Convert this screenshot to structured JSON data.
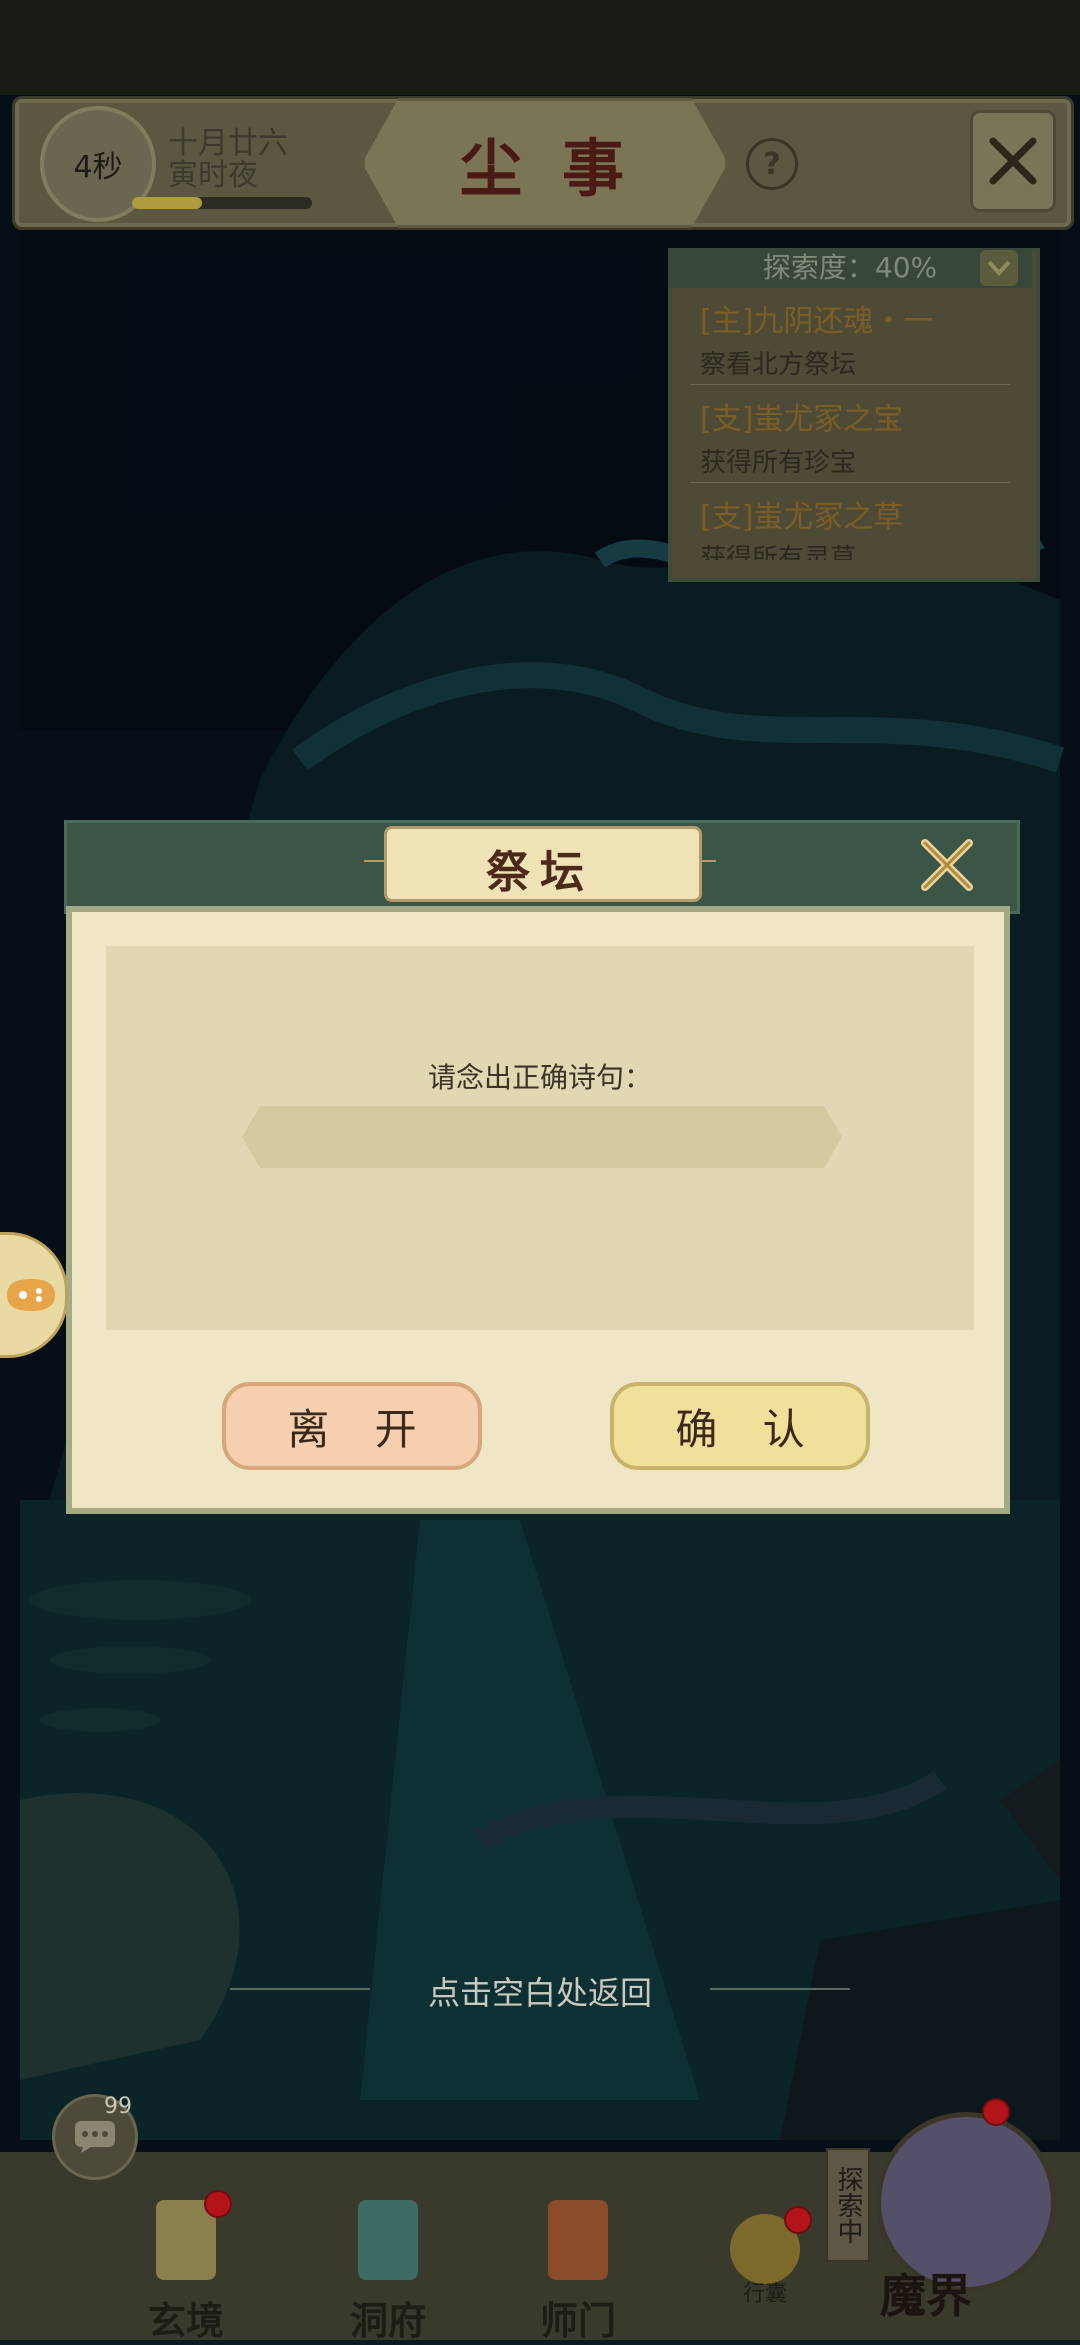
{
  "header": {
    "timer": "4秒",
    "date_line1": "十月廿六",
    "date_line2": "寅时夜",
    "title": "尘事",
    "help_icon": "question-icon",
    "close_icon": "crossed-swords-close-icon"
  },
  "quest_panel": {
    "progress_label": "探索度：40%",
    "quests": [
      {
        "title": "[主]九阴还魂・一",
        "desc": "察看北方祭坛"
      },
      {
        "title": "[支]蚩尤冢之宝",
        "desc": "获得所有珍宝"
      },
      {
        "title": "[支]蚩尤冢之草",
        "desc": "获得所有灵草"
      }
    ]
  },
  "dialog": {
    "title": "祭坛",
    "prompt": "请念出正确诗句：",
    "input_value": "",
    "input_placeholder": "",
    "leave_label": "离 开",
    "confirm_label": "确 认"
  },
  "return_hint": "点击空白处返回",
  "chat": {
    "badge": "99"
  },
  "bottom_nav": {
    "items": [
      {
        "label": "玄境"
      },
      {
        "label": "洞府"
      },
      {
        "label": "师门"
      }
    ],
    "bag_label": "行囊",
    "explore_tag": "探索中",
    "demon_realm_label": "魔界"
  },
  "colors": {
    "dialog_bg": "#efe6c6",
    "leave_btn": "#f5cfae",
    "confirm_btn": "#f0e19a",
    "header_bg": "#5b5740",
    "notify_dot": "#b3141a"
  }
}
